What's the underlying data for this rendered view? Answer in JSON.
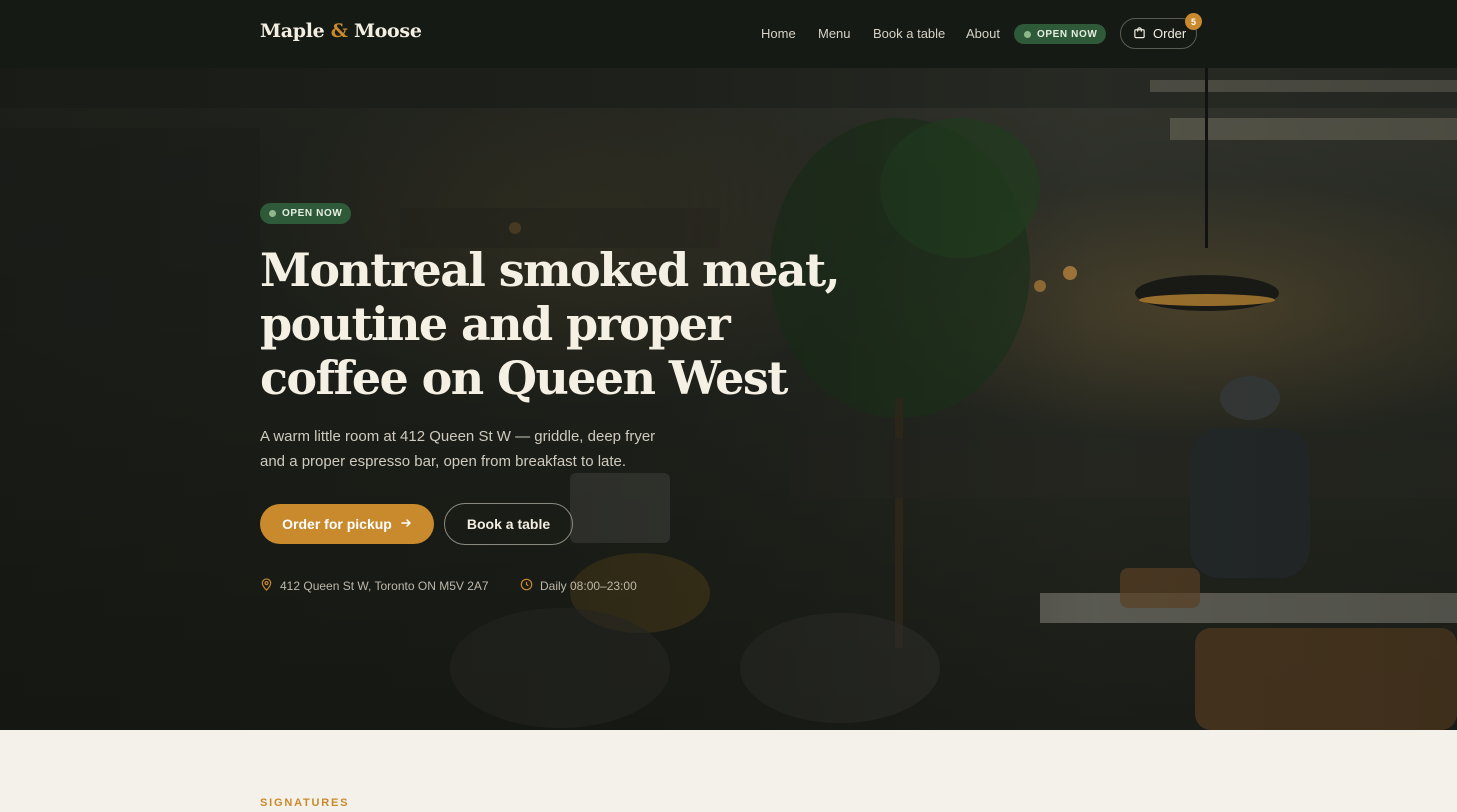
{
  "brand": {
    "name_part1": "Maple",
    "amp": "&",
    "name_part2": "Moose"
  },
  "nav": {
    "links": [
      "Home",
      "Menu",
      "Book a table",
      "About"
    ],
    "status_badge": "OPEN NOW",
    "order_label": "Order",
    "cart_count": "5"
  },
  "hero": {
    "status_pill": "OPEN NOW",
    "title_lines": [
      "Montreal smoked meat,",
      "poutine and proper",
      "coffee on Queen West"
    ],
    "subtitle_lines": [
      "A warm little room at 412 Queen St W — griddle, deep fryer",
      "and a proper espresso bar, open from breakfast to late."
    ],
    "primary_cta": "Order for pickup",
    "secondary_cta": "Book a table",
    "address": "412 Queen St W, Toronto ON M5V 2A7",
    "hours": "Daily 08:00–23:00"
  },
  "section": {
    "eyebrow": "SIGNATURES"
  },
  "colors": {
    "accent": "#c98a2e",
    "header_bg": "#161a14",
    "open_badge": "#2f5a3a",
    "page_bg": "#f4f1ea"
  },
  "icons": [
    "shopping-bag-icon",
    "arrow-right-icon",
    "map-pin-icon",
    "clock-icon"
  ]
}
